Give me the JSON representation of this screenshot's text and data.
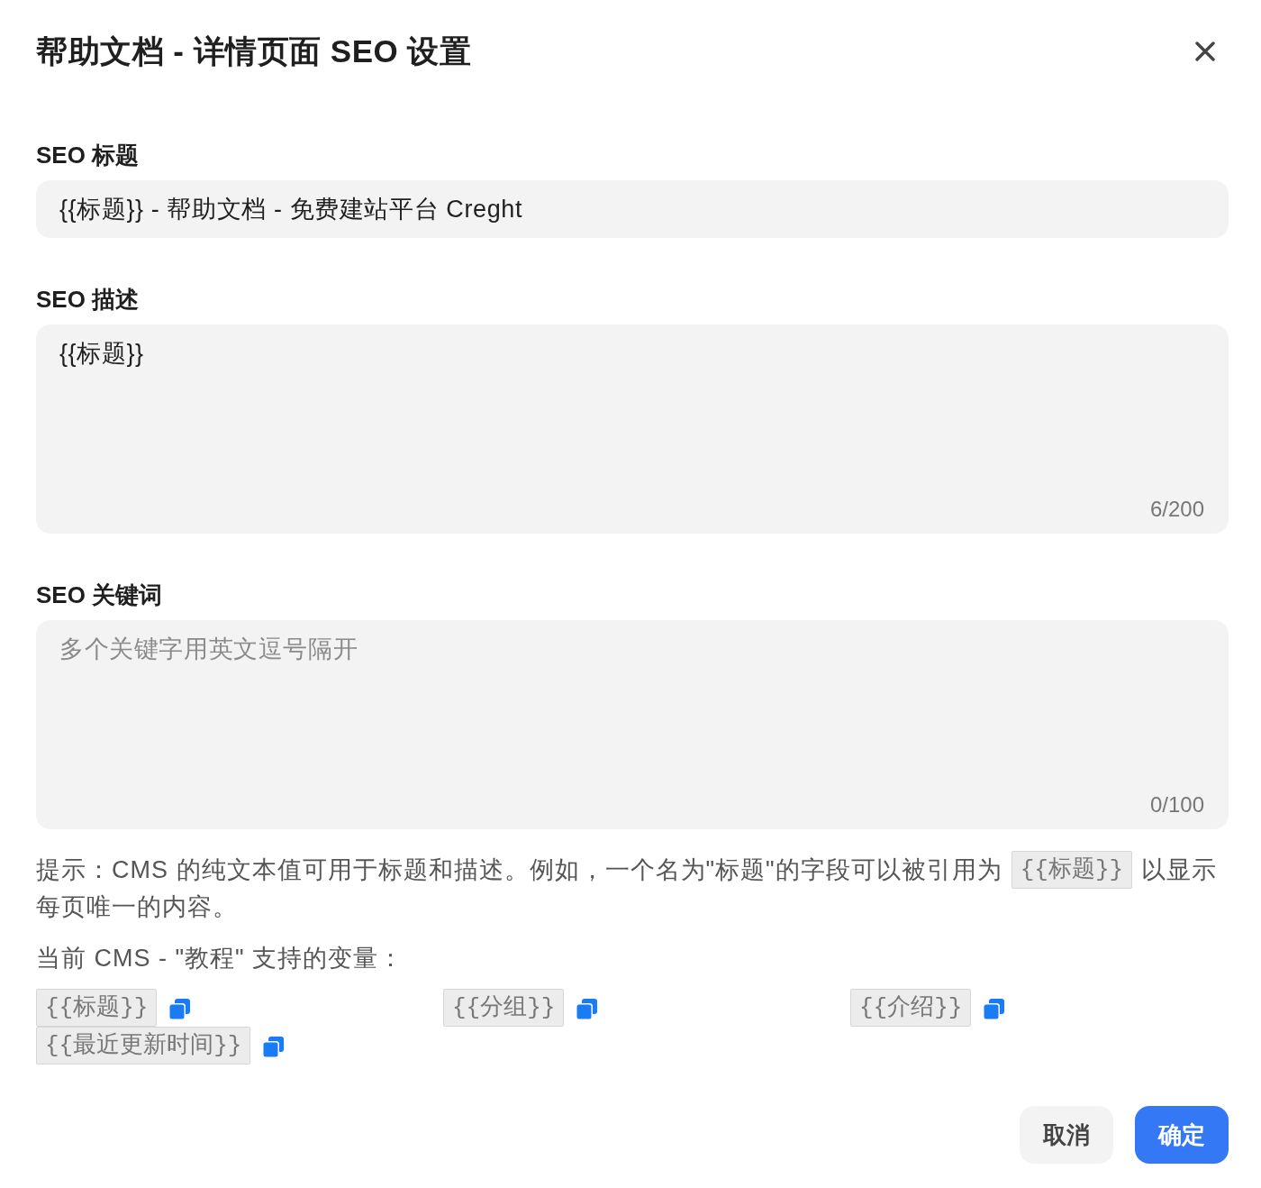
{
  "dialog": {
    "title": "帮助文档 - 详情页面 SEO 设置"
  },
  "fields": [
    {
      "kind": "input",
      "label": "SEO 标题",
      "value": "{{标题}} - 帮助文档 - 免费建站平台 Creght"
    },
    {
      "kind": "textarea",
      "label": "SEO 描述",
      "value": "{{标题}}",
      "counter": "6/200"
    },
    {
      "kind": "textarea",
      "label": "SEO 关键词",
      "placeholder": "多个关键字用英文逗号隔开",
      "counter": "0/100"
    }
  ],
  "hint_lines": [
    [
      {
        "kind": "text",
        "text": "提示：CMS 的纯文本值可用于标题和描述。例如，一个名为\"标题\"的字段可以被引用为"
      },
      {
        "kind": "code",
        "text": "{{标题}}"
      },
      {
        "kind": "text",
        "text": "以显示"
      }
    ],
    [
      {
        "kind": "text",
        "text": "每页唯一的内容。"
      }
    ]
  ],
  "variables": {
    "label": "当前 CMS - \"教程\" 支持的变量：",
    "items": [
      "{{标题}}",
      "{{分组}}",
      "{{介绍}}",
      "{{最近更新时间}}"
    ]
  },
  "buttons": [
    {
      "kind": "secondary",
      "label": "取消"
    },
    {
      "kind": "primary",
      "label": "确定"
    }
  ]
}
